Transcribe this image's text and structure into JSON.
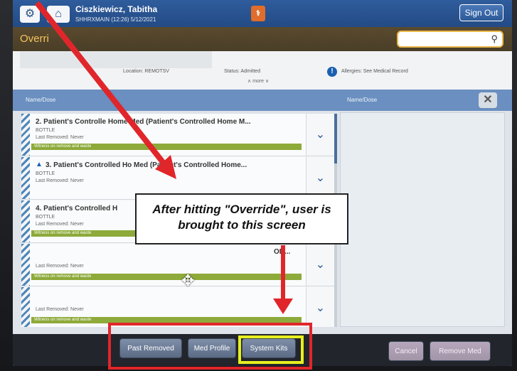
{
  "header": {
    "patient_name": "Ciszkiewicz, Tabitha",
    "session": "SHHRXMAIN (12:26) 5/12/2021",
    "sign_out": "Sign Out"
  },
  "title_bar": {
    "page_title": "Overri",
    "search_placeholder": ""
  },
  "info_bar": {
    "location": "Location: REMOTSV",
    "status": "Status: Admitted",
    "allergies": "Allergies: See Medical Record",
    "more": "∧ more ∨"
  },
  "columns": {
    "left_header": "Name/Dose",
    "right_header": "Name/Dose"
  },
  "items": [
    {
      "title": "2. Patient's Controlle   Home Med (Patient's Controlled Home M...",
      "form": "BOTTLE",
      "last_removed": "Last Removed: Never",
      "note": "Witness on remove and waste"
    },
    {
      "title": "3. Patient's Controlled Ho      Med (Patient's Controlled Home...",
      "form": "BOTTLE",
      "last_removed": "Last Removed: Never",
      "note": ""
    },
    {
      "title": "4. Patient's Controlled H",
      "form": "BOTTLE",
      "last_removed": "Last Removed: Never",
      "note": "Witness on remove and waste"
    },
    {
      "title": "OD...",
      "form": "",
      "last_removed": "Last Removed: Never",
      "note": "Witness on remove and waste"
    },
    {
      "title": "",
      "form": "",
      "last_removed": "Last Removed: Never",
      "note": "Witness on remove and waste"
    }
  ],
  "footer": {
    "past_removed": "Past Removed",
    "med_profile": "Med Profile",
    "system_kits": "System Kits",
    "cancel": "Cancel",
    "remove_med": "Remove Med"
  },
  "annotation": {
    "callout": "After hitting \"Override\", user is brought to this screen"
  },
  "colors": {
    "highlight_red": "#e0262a",
    "highlight_yellow": "#e8ef1f",
    "accent_blue": "#2b5a96"
  }
}
